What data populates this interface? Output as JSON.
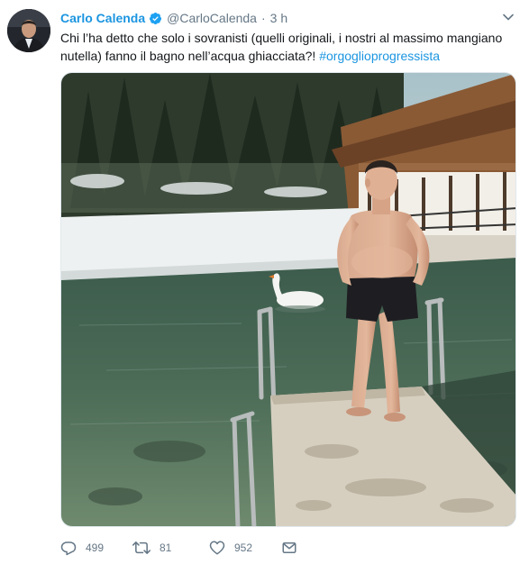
{
  "tweet": {
    "author": {
      "display_name": "Carlo Calenda",
      "handle": "@CarloCalenda",
      "verified": true,
      "avatar_icon": "profile-photo"
    },
    "separator": "·",
    "time": "3 h",
    "text_main": "Chi l’ha detto che solo i sovranisti (quelli originali, i nostri al massimo mangiano nutella) fanno il bagno nell’acqua ghiacciata?! ",
    "hashtag": "#orgoglioprogressista",
    "media": {
      "icon": "photo-man-standing-on-pier-by-frozen-lake-with-swan"
    },
    "actions": {
      "reply_count": "499",
      "retweet_count": "81",
      "like_count": "952"
    }
  },
  "colors": {
    "accent": "#1b95e0",
    "secondary_text": "#657786",
    "primary_text": "#14171a",
    "border": "#e1e8ed"
  },
  "icons": {
    "verified": "verified-badge-icon",
    "caret": "chevron-down-icon",
    "reply": "reply-icon",
    "retweet": "retweet-icon",
    "like": "heart-icon",
    "dm": "envelope-icon"
  }
}
